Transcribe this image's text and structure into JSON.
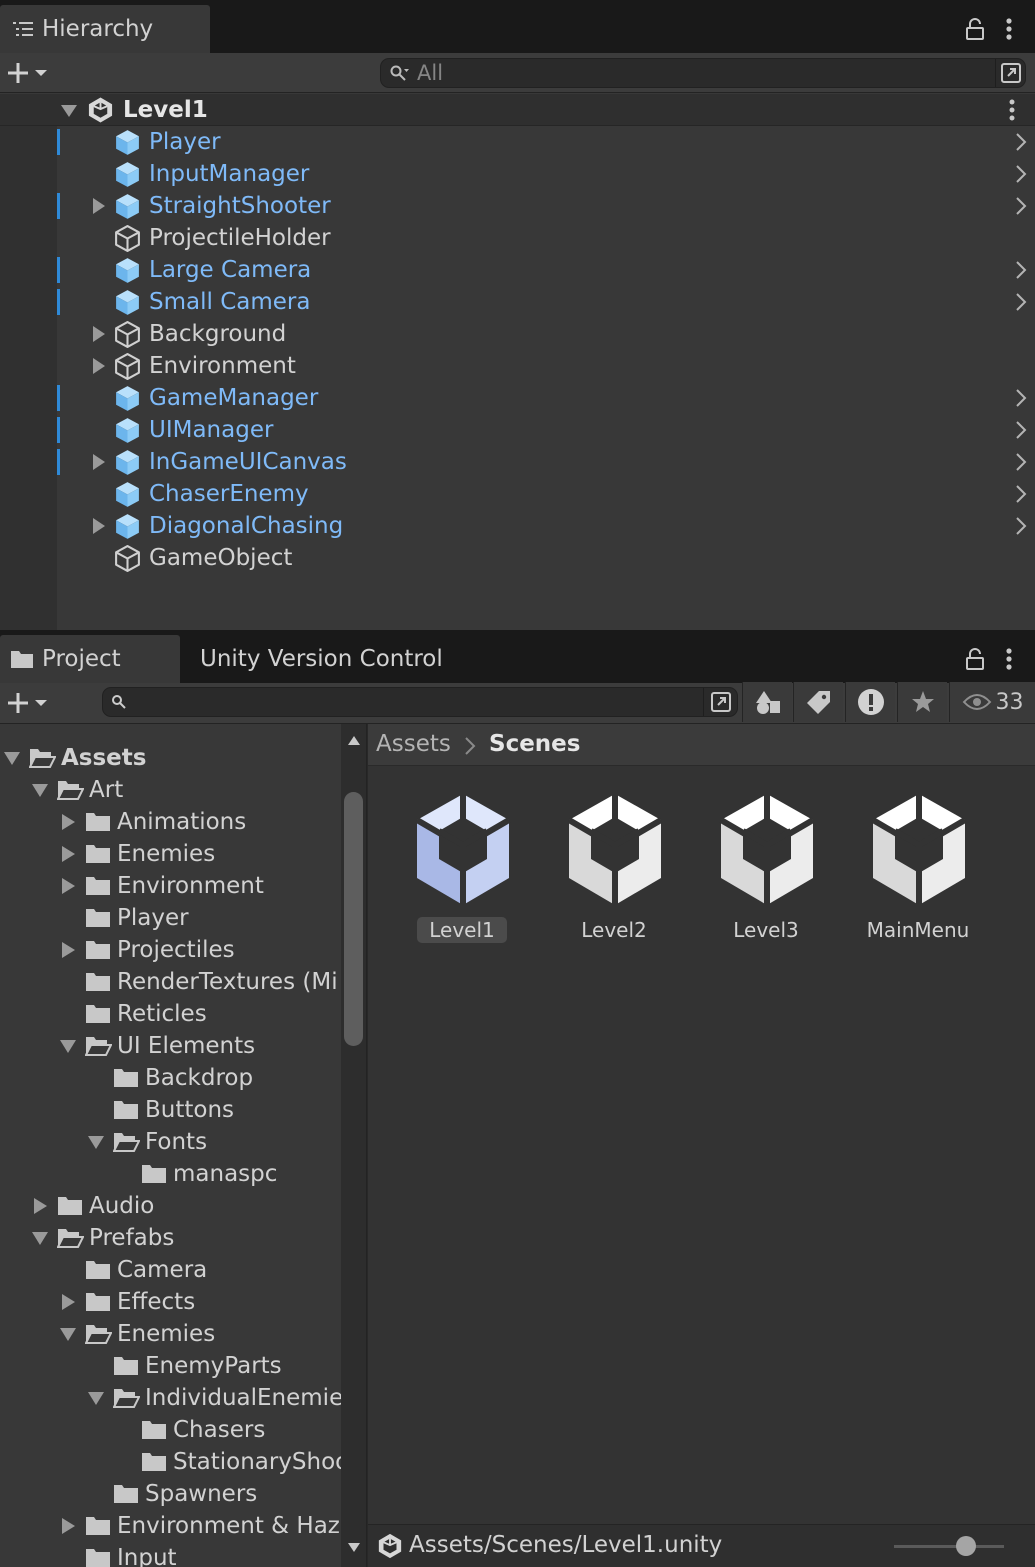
{
  "hierarchy": {
    "tab_label": "Hierarchy",
    "search_placeholder": "All",
    "scene_name": "Level1",
    "rows": [
      {
        "label": "Player",
        "prefab": true,
        "marked": true,
        "expandable": false,
        "chevron": true
      },
      {
        "label": "InputManager",
        "prefab": true,
        "marked": false,
        "expandable": false,
        "chevron": true
      },
      {
        "label": "StraightShooter",
        "prefab": true,
        "marked": true,
        "expandable": true,
        "chevron": true
      },
      {
        "label": "ProjectileHolder",
        "prefab": false,
        "marked": false,
        "expandable": false,
        "chevron": false
      },
      {
        "label": "Large Camera",
        "prefab": true,
        "marked": true,
        "expandable": false,
        "chevron": true
      },
      {
        "label": "Small Camera",
        "prefab": true,
        "marked": true,
        "expandable": false,
        "chevron": true
      },
      {
        "label": "Background",
        "prefab": false,
        "marked": false,
        "expandable": true,
        "chevron": false
      },
      {
        "label": "Environment",
        "prefab": false,
        "marked": false,
        "expandable": true,
        "chevron": false
      },
      {
        "label": "GameManager",
        "prefab": true,
        "marked": true,
        "expandable": false,
        "chevron": true
      },
      {
        "label": "UIManager",
        "prefab": true,
        "marked": true,
        "expandable": false,
        "chevron": true
      },
      {
        "label": "InGameUICanvas",
        "prefab": true,
        "marked": true,
        "expandable": true,
        "chevron": true
      },
      {
        "label": "ChaserEnemy",
        "prefab": true,
        "marked": false,
        "expandable": false,
        "chevron": true
      },
      {
        "label": "DiagonalChasing",
        "prefab": true,
        "marked": false,
        "expandable": true,
        "chevron": true
      },
      {
        "label": "GameObject",
        "prefab": false,
        "marked": false,
        "expandable": false,
        "chevron": false
      }
    ]
  },
  "project": {
    "tabs": [
      "Project",
      "Unity Version Control"
    ],
    "hidden_count": "33",
    "breadcrumb": {
      "root": "Assets",
      "current": "Scenes"
    },
    "tree": [
      {
        "label": "Assets",
        "depth": 0,
        "state": "open",
        "bold": true
      },
      {
        "label": "Art",
        "depth": 1,
        "state": "open"
      },
      {
        "label": "Animations",
        "depth": 2,
        "state": "closed"
      },
      {
        "label": "Enemies",
        "depth": 2,
        "state": "closed"
      },
      {
        "label": "Environment",
        "depth": 2,
        "state": "closed"
      },
      {
        "label": "Player",
        "depth": 2,
        "state": "none"
      },
      {
        "label": "Projectiles",
        "depth": 2,
        "state": "closed"
      },
      {
        "label": "RenderTextures (Mi",
        "depth": 2,
        "state": "none"
      },
      {
        "label": "Reticles",
        "depth": 2,
        "state": "none"
      },
      {
        "label": "UI Elements",
        "depth": 2,
        "state": "open"
      },
      {
        "label": "Backdrop",
        "depth": 3,
        "state": "none"
      },
      {
        "label": "Buttons",
        "depth": 3,
        "state": "none"
      },
      {
        "label": "Fonts",
        "depth": 3,
        "state": "open"
      },
      {
        "label": "manaspc",
        "depth": 4,
        "state": "none"
      },
      {
        "label": "Audio",
        "depth": 1,
        "state": "closed"
      },
      {
        "label": "Prefabs",
        "depth": 1,
        "state": "open"
      },
      {
        "label": "Camera",
        "depth": 2,
        "state": "none"
      },
      {
        "label": "Effects",
        "depth": 2,
        "state": "closed"
      },
      {
        "label": "Enemies",
        "depth": 2,
        "state": "open"
      },
      {
        "label": "EnemyParts",
        "depth": 3,
        "state": "none"
      },
      {
        "label": "IndividualEnemies",
        "depth": 3,
        "state": "open"
      },
      {
        "label": "Chasers",
        "depth": 4,
        "state": "none"
      },
      {
        "label": "StationaryShoo",
        "depth": 4,
        "state": "none"
      },
      {
        "label": "Spawners",
        "depth": 3,
        "state": "none"
      },
      {
        "label": "Environment & Haza",
        "depth": 2,
        "state": "closed"
      },
      {
        "label": "Input",
        "depth": 2,
        "state": "none"
      }
    ],
    "assets": [
      {
        "label": "Level1",
        "selected": true
      },
      {
        "label": "Level2",
        "selected": false
      },
      {
        "label": "Level3",
        "selected": false
      },
      {
        "label": "MainMenu",
        "selected": false
      }
    ],
    "status_path": "Assets/Scenes/Level1.unity",
    "zoom_slider": 0.65
  },
  "colors": {
    "prefab_text": "#7fbaf8",
    "prefab_icon": "#7fc3f5",
    "marker": "#2f8ad8",
    "selected_label_bg": "#4b4b4b"
  }
}
